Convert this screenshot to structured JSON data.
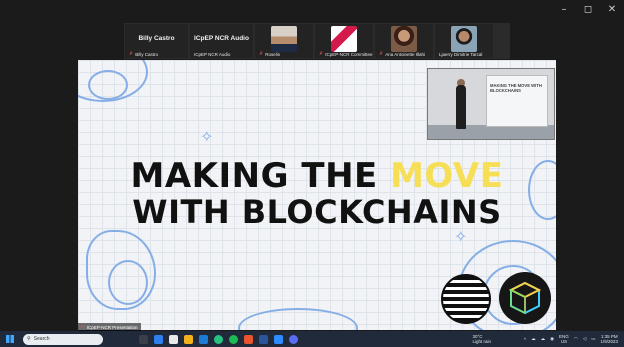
{
  "window_controls": {
    "minimize": "–",
    "maximize": "◻",
    "close": "✕"
  },
  "participants": [
    {
      "kind": "name",
      "display": "Billy Castro",
      "label": "Billy Castro"
    },
    {
      "kind": "name",
      "display": "ICpEP NCR Audio",
      "label": "ICpEP NCR Audio"
    },
    {
      "kind": "video",
      "label": "Roselin"
    },
    {
      "kind": "video",
      "label": "ICpEP-NCR Committee"
    },
    {
      "kind": "video",
      "label": "Ana Antoinette Illahi"
    },
    {
      "kind": "video",
      "label": "Ljaerry Dimitrie Tarcal"
    }
  ],
  "slide": {
    "line1_a": "MAKING THE ",
    "line1_highlight": "MOVE",
    "line2": "WITH BLOCKCHAINS",
    "speaker_screen_text": "MAKING THE MOVE WITH BLOCKCHAINS"
  },
  "presenter_label": "ICpEP-NCR Presentation",
  "taskbar": {
    "search_placeholder": "Search",
    "weather_temp": "30°C",
    "weather_desc": "Light rain",
    "lang_top": "ENG",
    "lang_bottom": "US",
    "time": "1:35 PM",
    "date": "1/9/2023"
  },
  "colors": {
    "highlight": "#f6df57",
    "taskbar": "#202a3a",
    "doodle": "#86aee6"
  }
}
